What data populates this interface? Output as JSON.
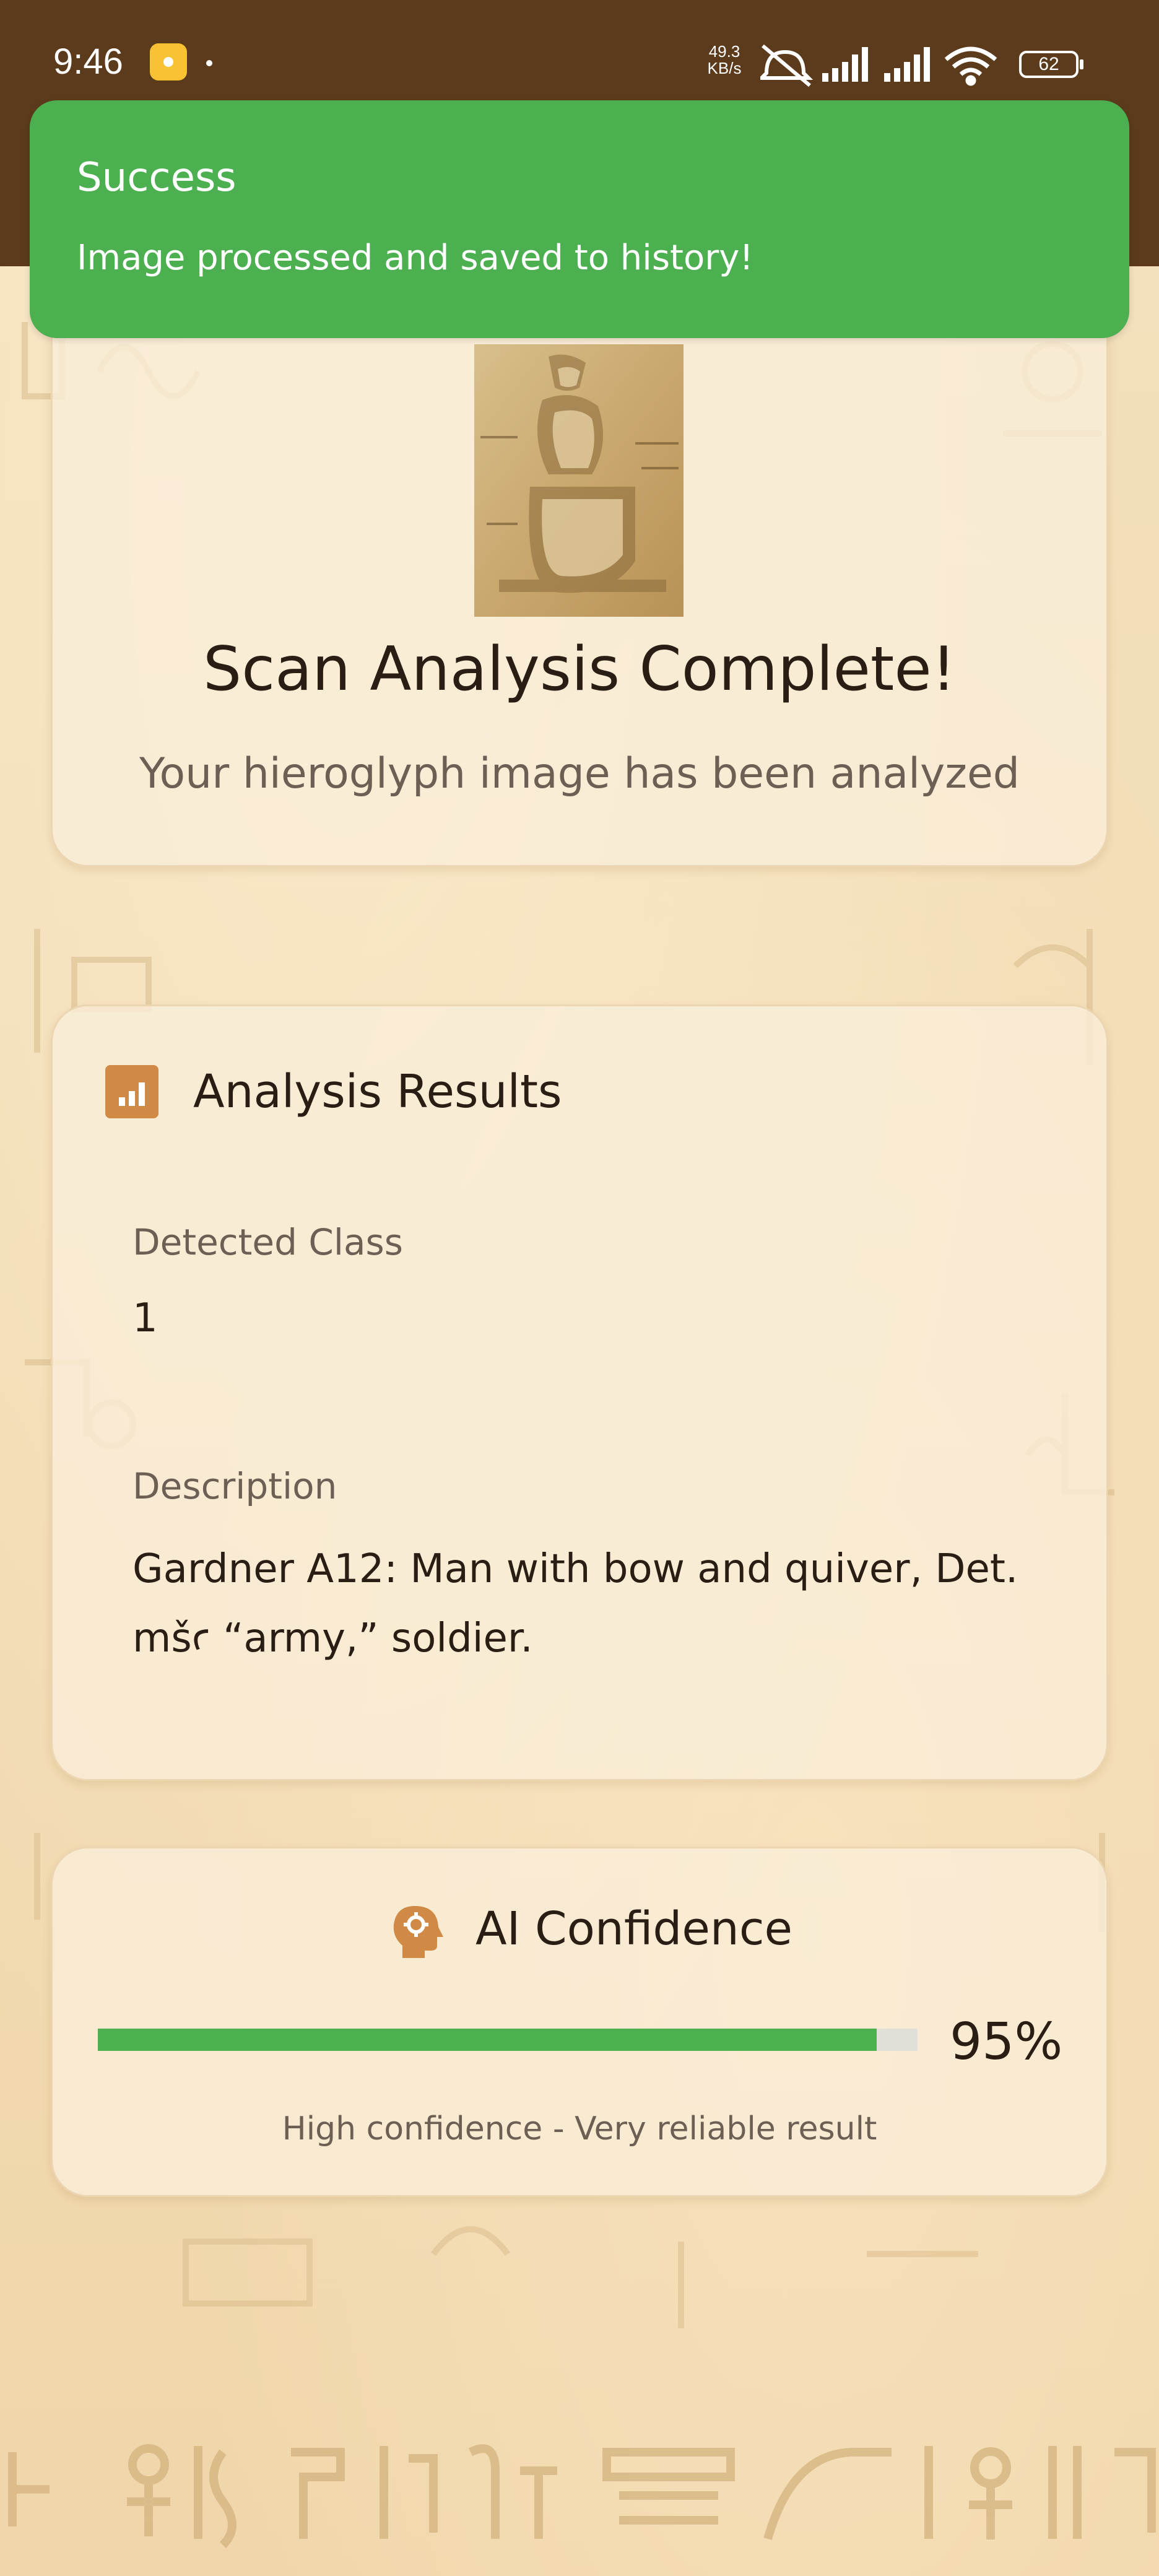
{
  "status_bar": {
    "time": "9:46",
    "net_speed": "49.3",
    "net_unit": "KB/s",
    "battery": "62",
    "icons": [
      "app-notification-icon",
      "mute-icon",
      "signal-icon",
      "signal-icon",
      "wifi-icon",
      "battery-icon"
    ]
  },
  "toast": {
    "title": "Success",
    "message": "Image processed and saved to history!",
    "color": "#4caf50"
  },
  "hero": {
    "title": "Scan Analysis Complete!",
    "subtitle": "Your hieroglyph image has been analyzed"
  },
  "results": {
    "section_title": "Analysis Results",
    "icon": "chart-icon",
    "detected_class_label": "Detected Class",
    "detected_class_value": "1",
    "description_label": "Description",
    "description_value": "Gardner A12: Man with bow and quiver, Det. mšꜥ “army,” soldier."
  },
  "confidence": {
    "section_title": "AI Confidence",
    "icon": "head-gear-icon",
    "value": 0.95,
    "percent_label": "95%",
    "note": "High confidence - Very reliable result",
    "bar_color": "#4caf50"
  },
  "theme": {
    "header_brown": "#5c3b1c",
    "accent_orange": "#d08a45",
    "text_dark": "#2a1e14",
    "text_muted": "#6e5f54"
  }
}
